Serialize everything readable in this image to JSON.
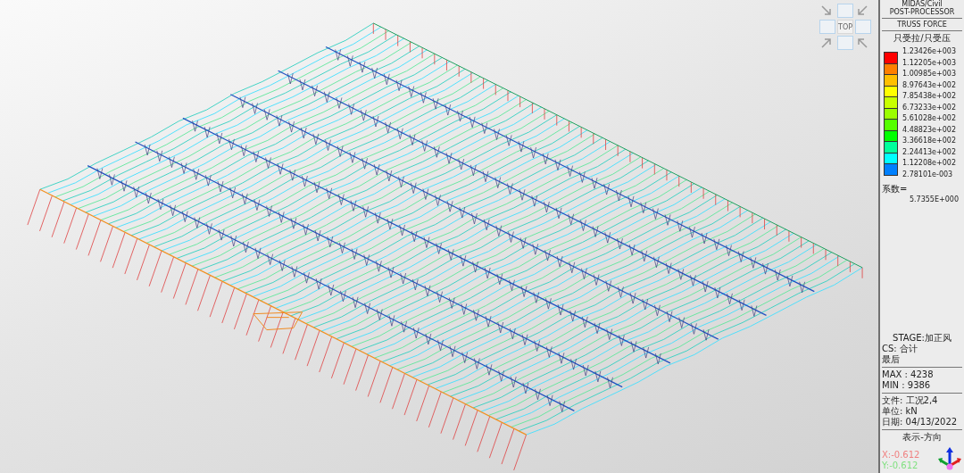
{
  "view_cube": {
    "label": "TOP"
  },
  "legend": {
    "header": [
      "MIDAS/Civil",
      "POST-PROCESSOR"
    ],
    "title": "TRUSS FORCE",
    "subtitle": "只受拉/只受压",
    "bands": [
      {
        "color": "#ff0000"
      },
      {
        "color": "#ff7f00"
      },
      {
        "color": "#ffbf00"
      },
      {
        "color": "#ffff00"
      },
      {
        "color": "#c8ff00"
      },
      {
        "color": "#9bff00"
      },
      {
        "color": "#55ff00"
      },
      {
        "color": "#00ff00"
      },
      {
        "color": "#00ff9c"
      },
      {
        "color": "#00ffff"
      },
      {
        "color": "#0080ff"
      }
    ],
    "values": [
      "1.23426e+003",
      "1.12205e+003",
      "1.00985e+003",
      "8.97643e+002",
      "7.85438e+002",
      "6.73233e+002",
      "5.61028e+002",
      "4.48823e+002",
      "3.36618e+002",
      "2.24413e+002",
      "1.12208e+002",
      "2.78101e-003"
    ],
    "factor_label": "系数=",
    "factor_value": "5.7355E+000"
  },
  "info": {
    "stage": "STAGE:加正风",
    "cs": "CS: 合计",
    "step": "最后",
    "max": "MAX : 4238",
    "min": "MIN : 9386",
    "file": "文件: 工况2,4",
    "unit": "单位: kN",
    "date": "日期: 04/13/2022",
    "direction_title": "表示-方向",
    "axes": [
      {
        "label": "X:-0.612",
        "color": "#f08080"
      },
      {
        "label": "Y:-0.612",
        "color": "#80e080"
      }
    ]
  }
}
